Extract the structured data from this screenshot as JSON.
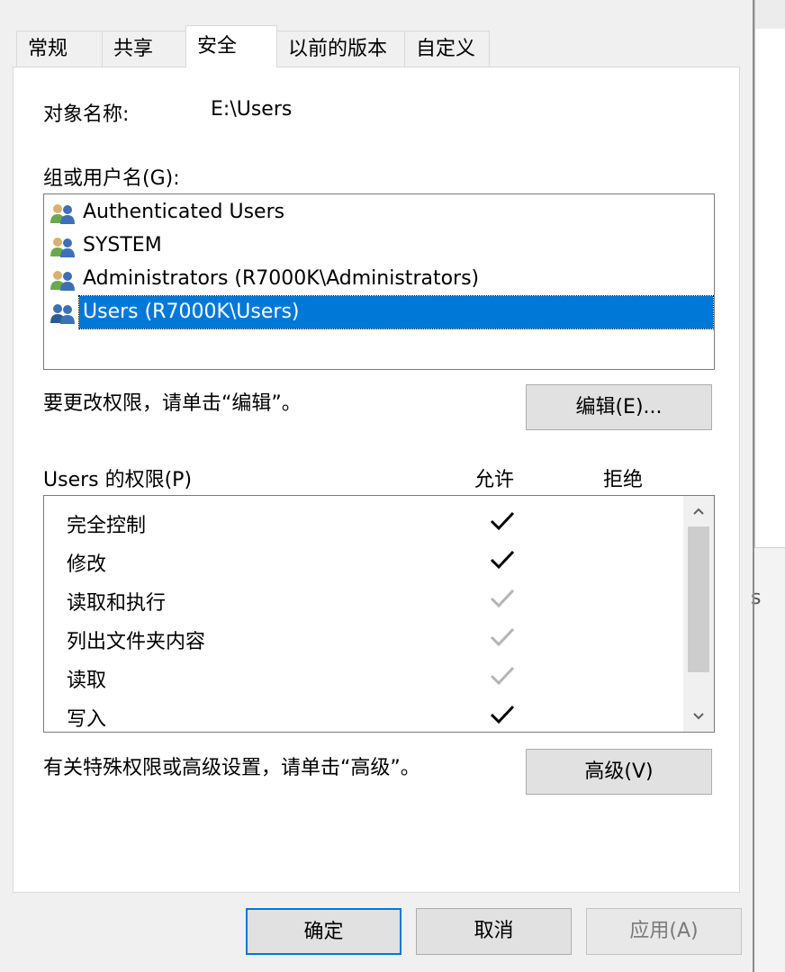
{
  "tabs": [
    {
      "label": "常规",
      "selected": false
    },
    {
      "label": "共享",
      "selected": false
    },
    {
      "label": "安全",
      "selected": true
    },
    {
      "label": "以前的版本",
      "selected": false
    },
    {
      "label": "自定义",
      "selected": false
    }
  ],
  "object": {
    "label": "对象名称:",
    "value": "E:\\Users"
  },
  "groups": {
    "label": "组或用户名(G):",
    "items": [
      {
        "name": "Authenticated Users",
        "icon": "users-group-icon",
        "selected": false
      },
      {
        "name": "SYSTEM",
        "icon": "users-group-icon",
        "selected": false
      },
      {
        "name": "Administrators (R7000K\\Administrators)",
        "icon": "users-group-icon",
        "selected": false
      },
      {
        "name": "Users (R7000K\\Users)",
        "icon": "users-group-icon",
        "selected": true
      }
    ]
  },
  "edit": {
    "hint": "要更改权限，请单击“编辑”。",
    "button_label": "编辑(E)..."
  },
  "permissions": {
    "label": "Users 的权限(P)",
    "allow_header": "允许",
    "deny_header": "拒绝",
    "rows": [
      {
        "name": "完全控制",
        "allow": "check-explicit"
      },
      {
        "name": "修改",
        "allow": "check-explicit"
      },
      {
        "name": "读取和执行",
        "allow": "check-inherited"
      },
      {
        "name": "列出文件夹内容",
        "allow": "check-inherited"
      },
      {
        "name": "读取",
        "allow": "check-inherited"
      },
      {
        "name": "写入",
        "allow": "check-explicit"
      }
    ]
  },
  "advanced": {
    "hint": "有关特殊权限或高级设置，请单击“高级”。",
    "button_label": "高级(V)"
  },
  "footer": {
    "ok_label": "确定",
    "cancel_label": "取消",
    "apply_label": "应用(A)"
  },
  "background_window": {
    "partial_text": "s"
  },
  "colors": {
    "selection": "#0078d7",
    "check_explicit": "#000000",
    "check_inherited": "#b4b4b4"
  }
}
